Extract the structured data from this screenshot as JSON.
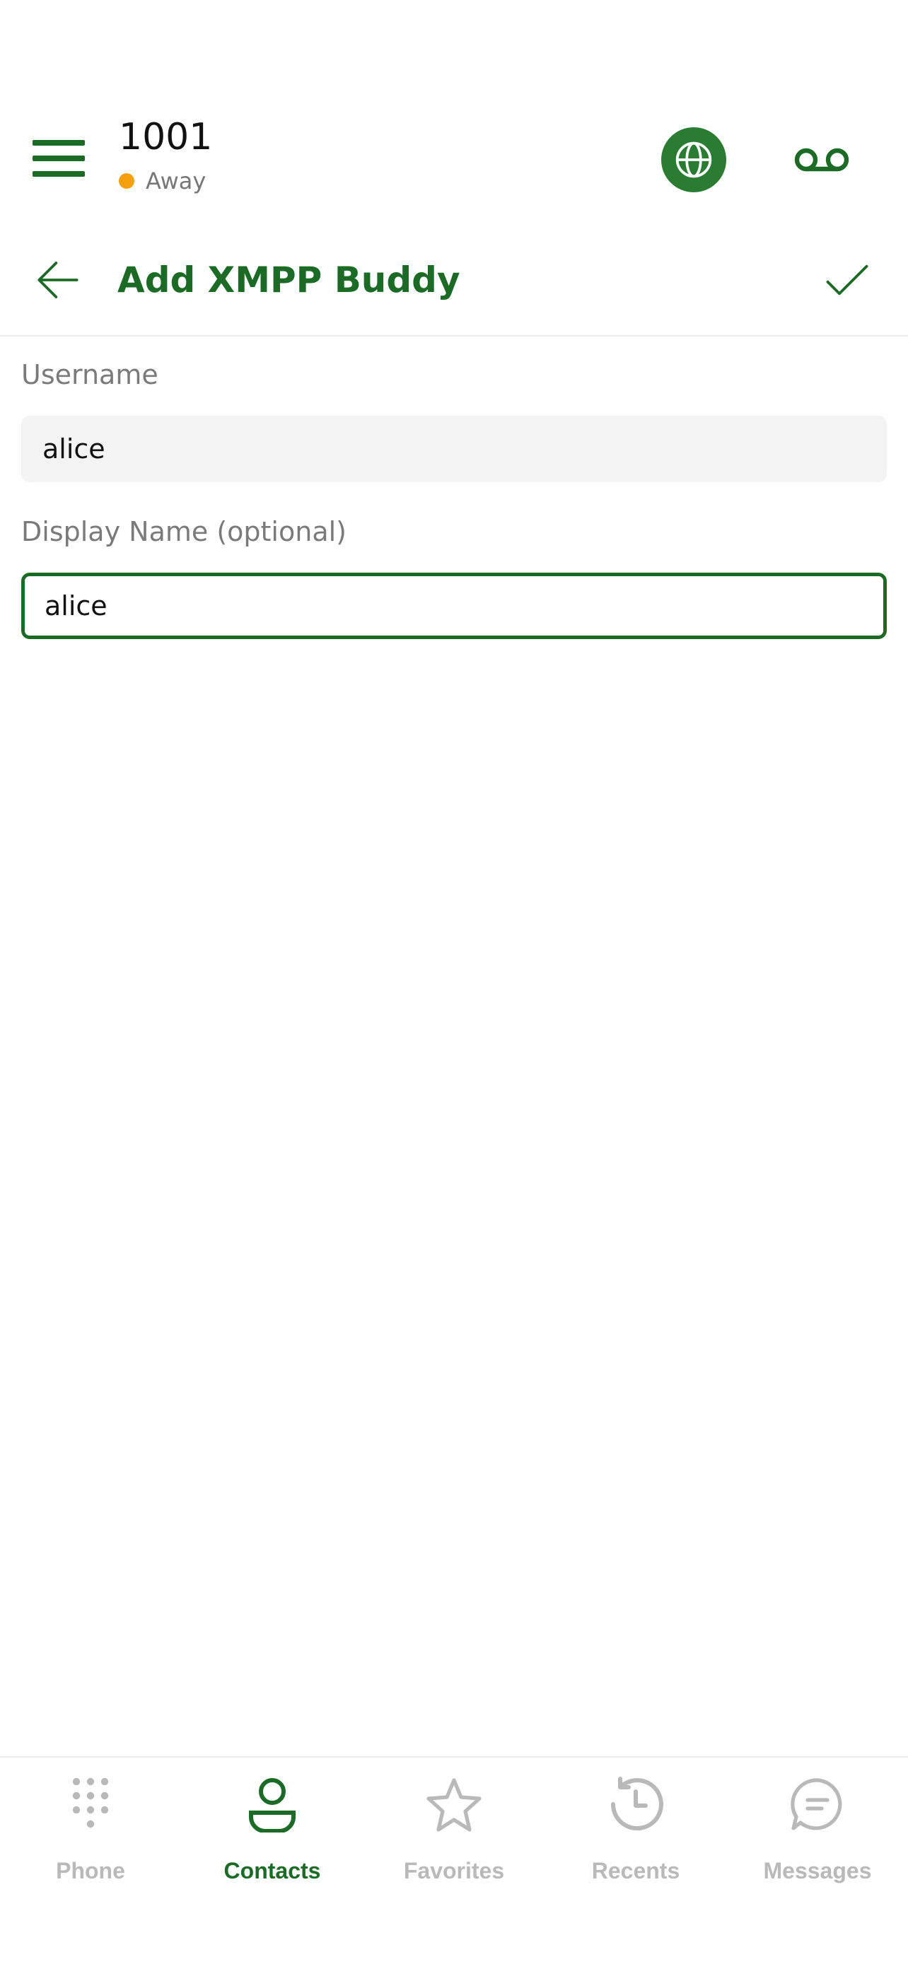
{
  "header": {
    "account_number": "1001",
    "status_text": "Away",
    "status_color": "#f5a00a",
    "icons": {
      "menu": "menu-icon",
      "globe": "globe-icon",
      "voicemail": "voicemail-icon"
    }
  },
  "titlebar": {
    "title": "Add XMPP Buddy",
    "icons": {
      "back": "arrow-left-icon",
      "confirm": "checkmark-icon"
    }
  },
  "form": {
    "username_label": "Username",
    "username_value": "alice",
    "display_name_label": "Display Name (optional)",
    "display_name_value": "alice"
  },
  "bottom_nav": {
    "items": [
      {
        "label": "Phone",
        "icon": "dialpad-icon",
        "active": false
      },
      {
        "label": "Contacts",
        "icon": "person-icon",
        "active": true
      },
      {
        "label": "Favorites",
        "icon": "star-icon",
        "active": false
      },
      {
        "label": "Recents",
        "icon": "history-clock-icon",
        "active": false
      },
      {
        "label": "Messages",
        "icon": "chat-bubble-icon",
        "active": false
      }
    ]
  },
  "colors": {
    "accent": "#1b6b26",
    "inactive_nav": "#b9b9b9",
    "label_gray": "#7a7a7a",
    "input_fill": "#f3f3f3"
  }
}
